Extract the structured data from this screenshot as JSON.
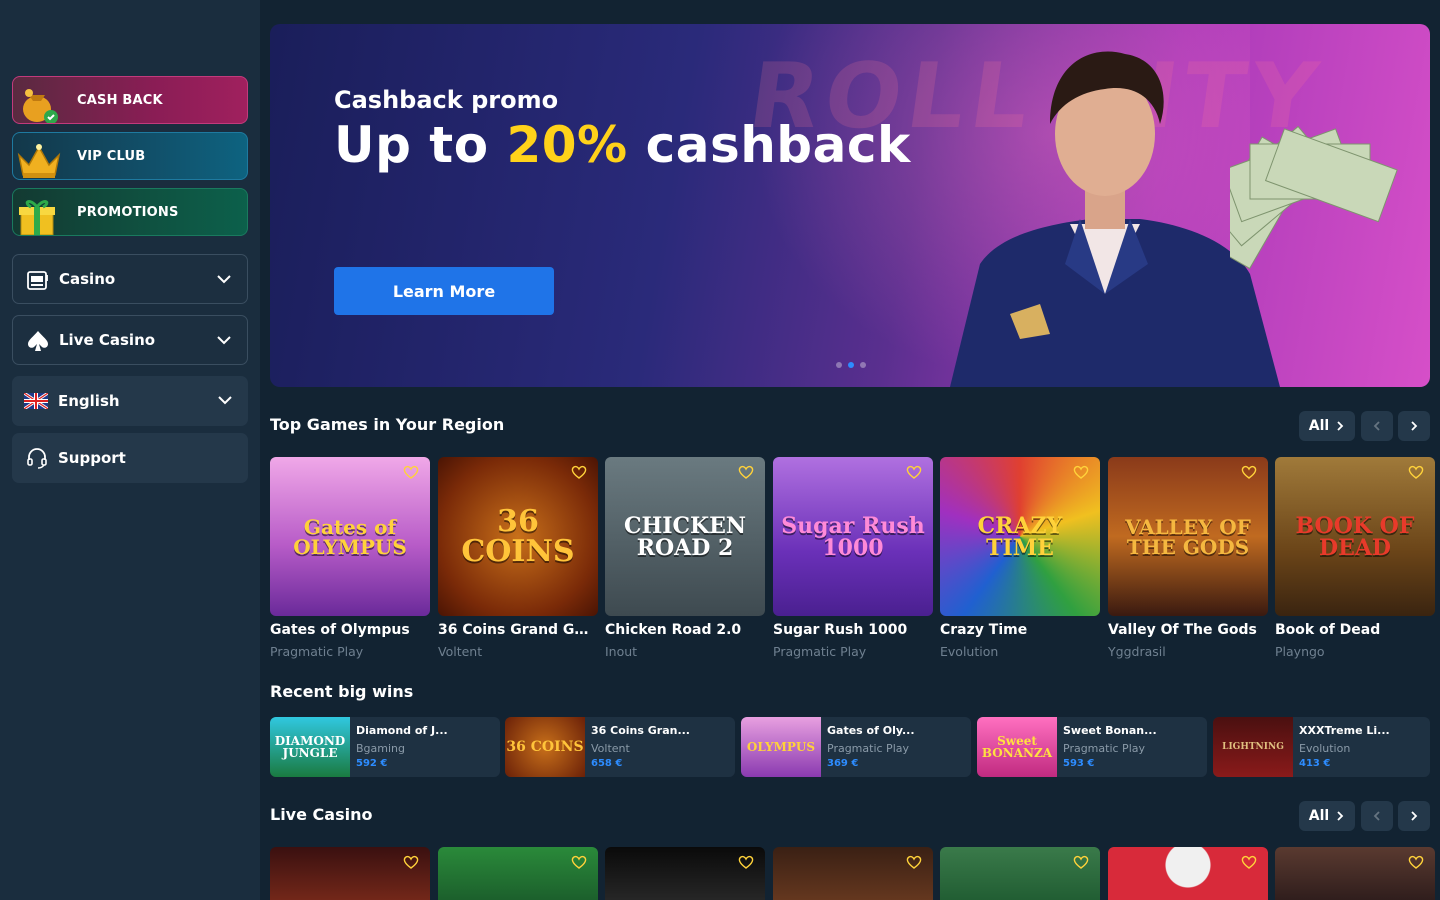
{
  "sidebar": {
    "promos": [
      {
        "label": "CASH BACK",
        "icon": "cashback-bag-icon"
      },
      {
        "label": "VIP CLUB",
        "icon": "crown-icon"
      },
      {
        "label": "PROMOTIONS",
        "icon": "gift-icon"
      }
    ],
    "menu": [
      {
        "label": "Casino",
        "icon": "slot-machine-icon"
      },
      {
        "label": "Live Casino",
        "icon": "spade-icon"
      },
      {
        "label": "English",
        "icon": "uk-flag-icon"
      },
      {
        "label": "Support",
        "icon": "headset-icon"
      }
    ]
  },
  "hero": {
    "eyebrow": "Cashback promo",
    "title_pre": "Up to ",
    "title_highlight": "20%",
    "title_post": " cashback",
    "cta": "Learn More",
    "bg_text": "ROLL CITY",
    "active_slide": 2,
    "slide_count": 3
  },
  "top_games": {
    "title": "Top Games in Your Region",
    "all_label": "All",
    "items": [
      {
        "name": "Gates of Olympus",
        "provider": "Pragmatic Play",
        "art": "Gates of OLYMPUS"
      },
      {
        "name": "36 Coins Grand Gold...",
        "provider": "Voltent",
        "art": "36 COINS"
      },
      {
        "name": "Chicken Road 2.0",
        "provider": "Inout",
        "art": "CHICKEN ROAD 2"
      },
      {
        "name": "Sugar Rush 1000",
        "provider": "Pragmatic Play",
        "art": "Sugar Rush 1000"
      },
      {
        "name": "Crazy Time",
        "provider": "Evolution",
        "art": "CRAZY TIME"
      },
      {
        "name": "Valley Of The Gods",
        "provider": "Yggdrasil",
        "art": "VALLEY OF THE GODS"
      },
      {
        "name": "Book of Dead",
        "provider": "Playngo",
        "art": "BOOK OF DEAD"
      }
    ]
  },
  "recent_wins": {
    "title": "Recent big wins",
    "items": [
      {
        "name": "Diamond of J...",
        "provider": "Bgaming",
        "amount": "592 €",
        "art": "DIAMOND JUNGLE"
      },
      {
        "name": "36 Coins Gran...",
        "provider": "Voltent",
        "amount": "658 €",
        "art": "36 COINS"
      },
      {
        "name": "Gates of Oly...",
        "provider": "Pragmatic Play",
        "amount": "369 €",
        "art": "OLYMPUS"
      },
      {
        "name": "Sweet Bonan...",
        "provider": "Pragmatic Play",
        "amount": "593 €",
        "art": "Sweet BONANZA"
      },
      {
        "name": "XXXTreme Li...",
        "provider": "Evolution",
        "amount": "413 €",
        "art": "LIGHTNING"
      }
    ]
  },
  "live_casino": {
    "title": "Live Casino",
    "all_label": "All"
  },
  "colors": {
    "page_bg": "#122332",
    "sidebar_bg": "#1a2d3e",
    "accent_blue": "#1f74e8",
    "highlight_yellow": "#ffd21a"
  }
}
